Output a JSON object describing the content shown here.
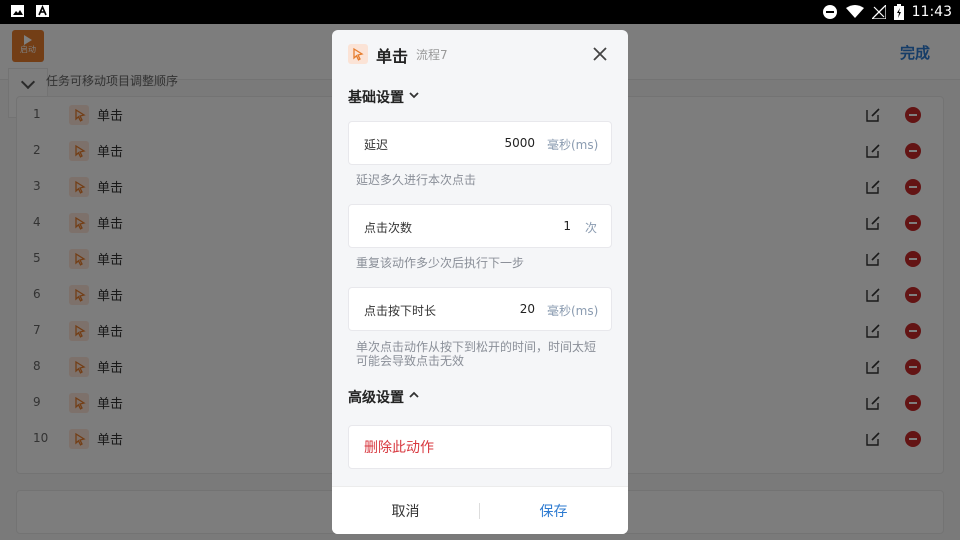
{
  "status_bar": {
    "time": "11:43"
  },
  "toolbar": {
    "done_label": "完成",
    "start_label": "启动",
    "expand_label": "展开",
    "hint": "任务可移动项目调整顺序"
  },
  "list": {
    "items": [
      {
        "index": "1",
        "label": "单击"
      },
      {
        "index": "2",
        "label": "单击"
      },
      {
        "index": "3",
        "label": "单击"
      },
      {
        "index": "4",
        "label": "单击"
      },
      {
        "index": "5",
        "label": "单击"
      },
      {
        "index": "6",
        "label": "单击"
      },
      {
        "index": "7",
        "label": "单击"
      },
      {
        "index": "8",
        "label": "单击"
      },
      {
        "index": "9",
        "label": "单击"
      },
      {
        "index": "10",
        "label": "单击"
      }
    ]
  },
  "dialog": {
    "title": "单击",
    "subtitle": "流程7",
    "basic_section": "基础设置",
    "advanced_section": "高级设置",
    "fields": [
      {
        "label": "延迟",
        "value": "5000",
        "unit": "毫秒(ms)",
        "help": "延迟多久进行本次点击"
      },
      {
        "label": "点击次数",
        "value": "1",
        "unit": "次",
        "help": "重复该动作多少次后执行下一步"
      },
      {
        "label": "点击按下时长",
        "value": "20",
        "unit": "毫秒(ms)",
        "help": "单次点击动作从按下到松开的时间，时间太短可能会导致点击无效"
      }
    ],
    "delete_label": "删除此动作",
    "cancel_label": "取消",
    "save_label": "保存"
  },
  "colors": {
    "accent": "#2d7bd1",
    "danger": "#d8383f",
    "start": "#e67c2c"
  }
}
